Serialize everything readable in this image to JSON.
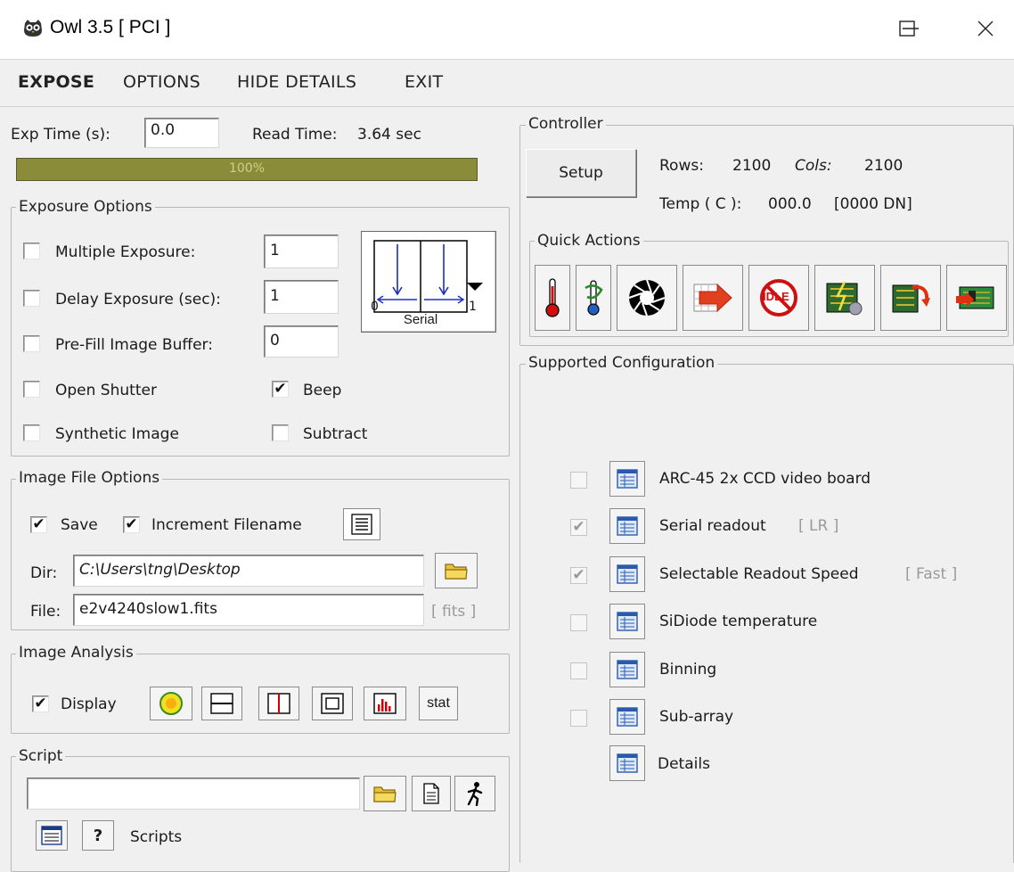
{
  "window": {
    "title": "Owl 3.5 [ PCI ]"
  },
  "menu": {
    "expose": "EXPOSE",
    "options": "OPTIONS",
    "hide_details": "HIDE DETAILS",
    "exit": "EXIT"
  },
  "exposure": {
    "exp_time_label": "Exp Time (s):",
    "exp_time_value": "0.0",
    "read_time_label": "Read Time:",
    "read_time_value": "3.64 sec",
    "progress_label": "100%",
    "progress_fraction": 1.0
  },
  "exposure_options": {
    "title": "Exposure Options",
    "multiple_exposure_label": "Multiple Exposure:",
    "multiple_exposure_value": "1",
    "delay_exposure_label": "Delay Exposure (sec):",
    "delay_exposure_value": "1",
    "prefill_label": "Pre-Fill Image Buffer:",
    "prefill_value": "0",
    "open_shutter_label": "Open Shutter",
    "beep_label": "Beep",
    "beep_check": "✔",
    "synthetic_label": "Synthetic Image",
    "subtract_label": "Subtract",
    "readout_diagram": {
      "label": "Serial",
      "left_tick": "0",
      "right_tick": "1"
    }
  },
  "image_file_options": {
    "title": "Image File Options",
    "save_label": "Save",
    "save_check": "✔",
    "increment_label": "Increment Filename",
    "increment_check": "✔",
    "dir_label": "Dir:",
    "dir_value": "C:\\Users\\tng\\Desktop",
    "file_label": "File:",
    "file_value": "e2v4240slow1.fits",
    "file_ext": "[ fits ]"
  },
  "image_analysis": {
    "title": "Image Analysis",
    "display_label": "Display",
    "display_check": "✔",
    "stat_label": "stat"
  },
  "script": {
    "title": "Script",
    "path_value": "",
    "scripts_label": "Scripts",
    "help_glyph": "?"
  },
  "controller": {
    "title": "Controller",
    "setup_label": "Setup",
    "rows_label": "Rows:",
    "rows_value": "2100",
    "cols_label": "Cols:",
    "cols_value": "2100",
    "temp_label": "Temp ( C ):",
    "temp_value": "000.0",
    "temp_dn": "[0000 DN]"
  },
  "quick_actions": {
    "title": "Quick Actions",
    "idle_text": "IDLE"
  },
  "supported_configuration": {
    "title": "Supported Configuration",
    "items": [
      {
        "label": "ARC-45 2x CCD video board",
        "tag": "",
        "check": ""
      },
      {
        "label": "Serial readout",
        "tag": "[ LR ]",
        "check": "✔"
      },
      {
        "label": "Selectable Readout Speed",
        "tag": "[ Fast ]",
        "check": "✔"
      },
      {
        "label": "SiDiode temperature",
        "tag": "",
        "check": ""
      },
      {
        "label": "Binning",
        "tag": "",
        "check": ""
      },
      {
        "label": "Sub-array",
        "tag": "",
        "check": ""
      }
    ],
    "details_label": "Details"
  },
  "colors": {
    "progress_fill": "#8a8c3a",
    "progress_text": "#cfd08a",
    "group_border": "#b8b8b8"
  },
  "icons": [
    "owl-app-icon",
    "minimize-icon",
    "maximize-icon",
    "close-icon",
    "folder-icon",
    "document-icon",
    "run-script-icon",
    "list-view-icon",
    "help-icon",
    "thermometer-icon",
    "cooling-icon",
    "shutter-icon",
    "readout-arrow-icon",
    "idle-icon",
    "power-on-icon",
    "reset-icon",
    "board-icon"
  ]
}
